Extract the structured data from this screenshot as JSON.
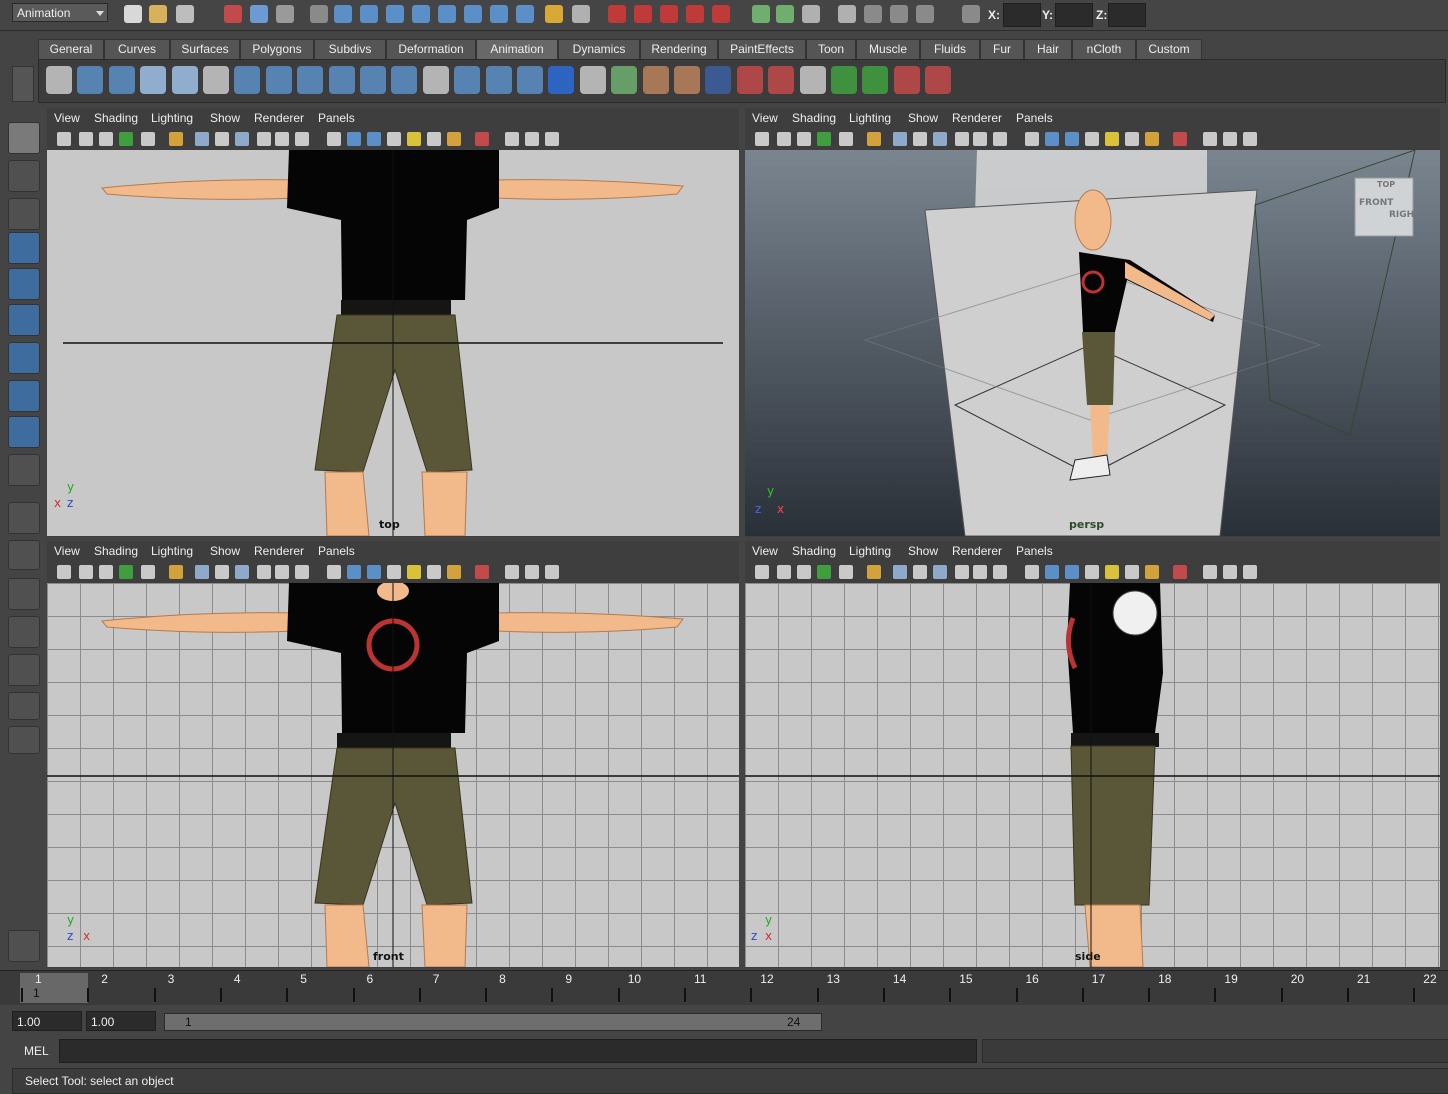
{
  "status_line": {
    "menu_set": "Animation",
    "coords": {
      "x_label": "X:",
      "y_label": "Y:",
      "z_label": "Z:"
    }
  },
  "shelf_tabs": [
    "General",
    "Curves",
    "Surfaces",
    "Polygons",
    "Subdivs",
    "Deformation",
    "Animation",
    "Dynamics",
    "Rendering",
    "PaintEffects",
    "Toon",
    "Muscle",
    "Fluids",
    "Fur",
    "Hair",
    "nCloth",
    "Custom"
  ],
  "active_tab": "Animation",
  "panel_menu": [
    "View",
    "Shading",
    "Lighting",
    "Show",
    "Renderer",
    "Panels"
  ],
  "viewports": {
    "top": {
      "label": "top"
    },
    "persp": {
      "label": "persp",
      "cube_front": "FRONT",
      "cube_right": "RIGHT",
      "cube_top": "TOP"
    },
    "front": {
      "label": "front"
    },
    "side": {
      "label": "side"
    }
  },
  "axis_labels": {
    "x": "x",
    "y": "y",
    "z": "z"
  },
  "timeline": {
    "ticks": [
      "1",
      "2",
      "3",
      "4",
      "5",
      "6",
      "7",
      "8",
      "9",
      "10",
      "11",
      "12",
      "13",
      "14",
      "15",
      "16",
      "17",
      "18",
      "19",
      "20",
      "21",
      "22"
    ],
    "current_frame": "1"
  },
  "range": {
    "start_time": "1.00",
    "playback_start": "1.00",
    "range_start": "1",
    "range_end": "24"
  },
  "command_line": {
    "label": "MEL"
  },
  "help_line": {
    "text": "Select Tool: select an object"
  },
  "colors": {
    "accent": "#5b8fc7",
    "bg": "#444444",
    "viewport_bg": "#c8c8c8",
    "shirt": "#050505",
    "shorts": "#5a5638",
    "skin": "#f2b98a"
  }
}
